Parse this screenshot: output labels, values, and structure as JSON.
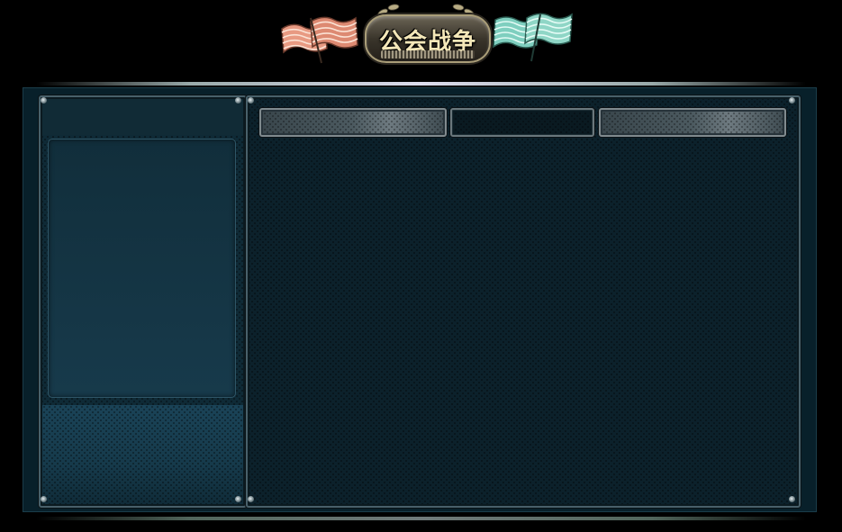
{
  "banner": {
    "title": "公会战争",
    "left_flag_color": "#e89a82",
    "right_flag_color": "#8fd6c6",
    "plate_color": "#3a352b"
  },
  "tabs": [
    {
      "label": "",
      "active": false
    },
    {
      "label": "",
      "active": true
    },
    {
      "label": "",
      "active": false
    }
  ],
  "colors": {
    "frame": "#08202a",
    "panel": "#0c212b",
    "card": "#173a4b",
    "border": "#48606a"
  }
}
